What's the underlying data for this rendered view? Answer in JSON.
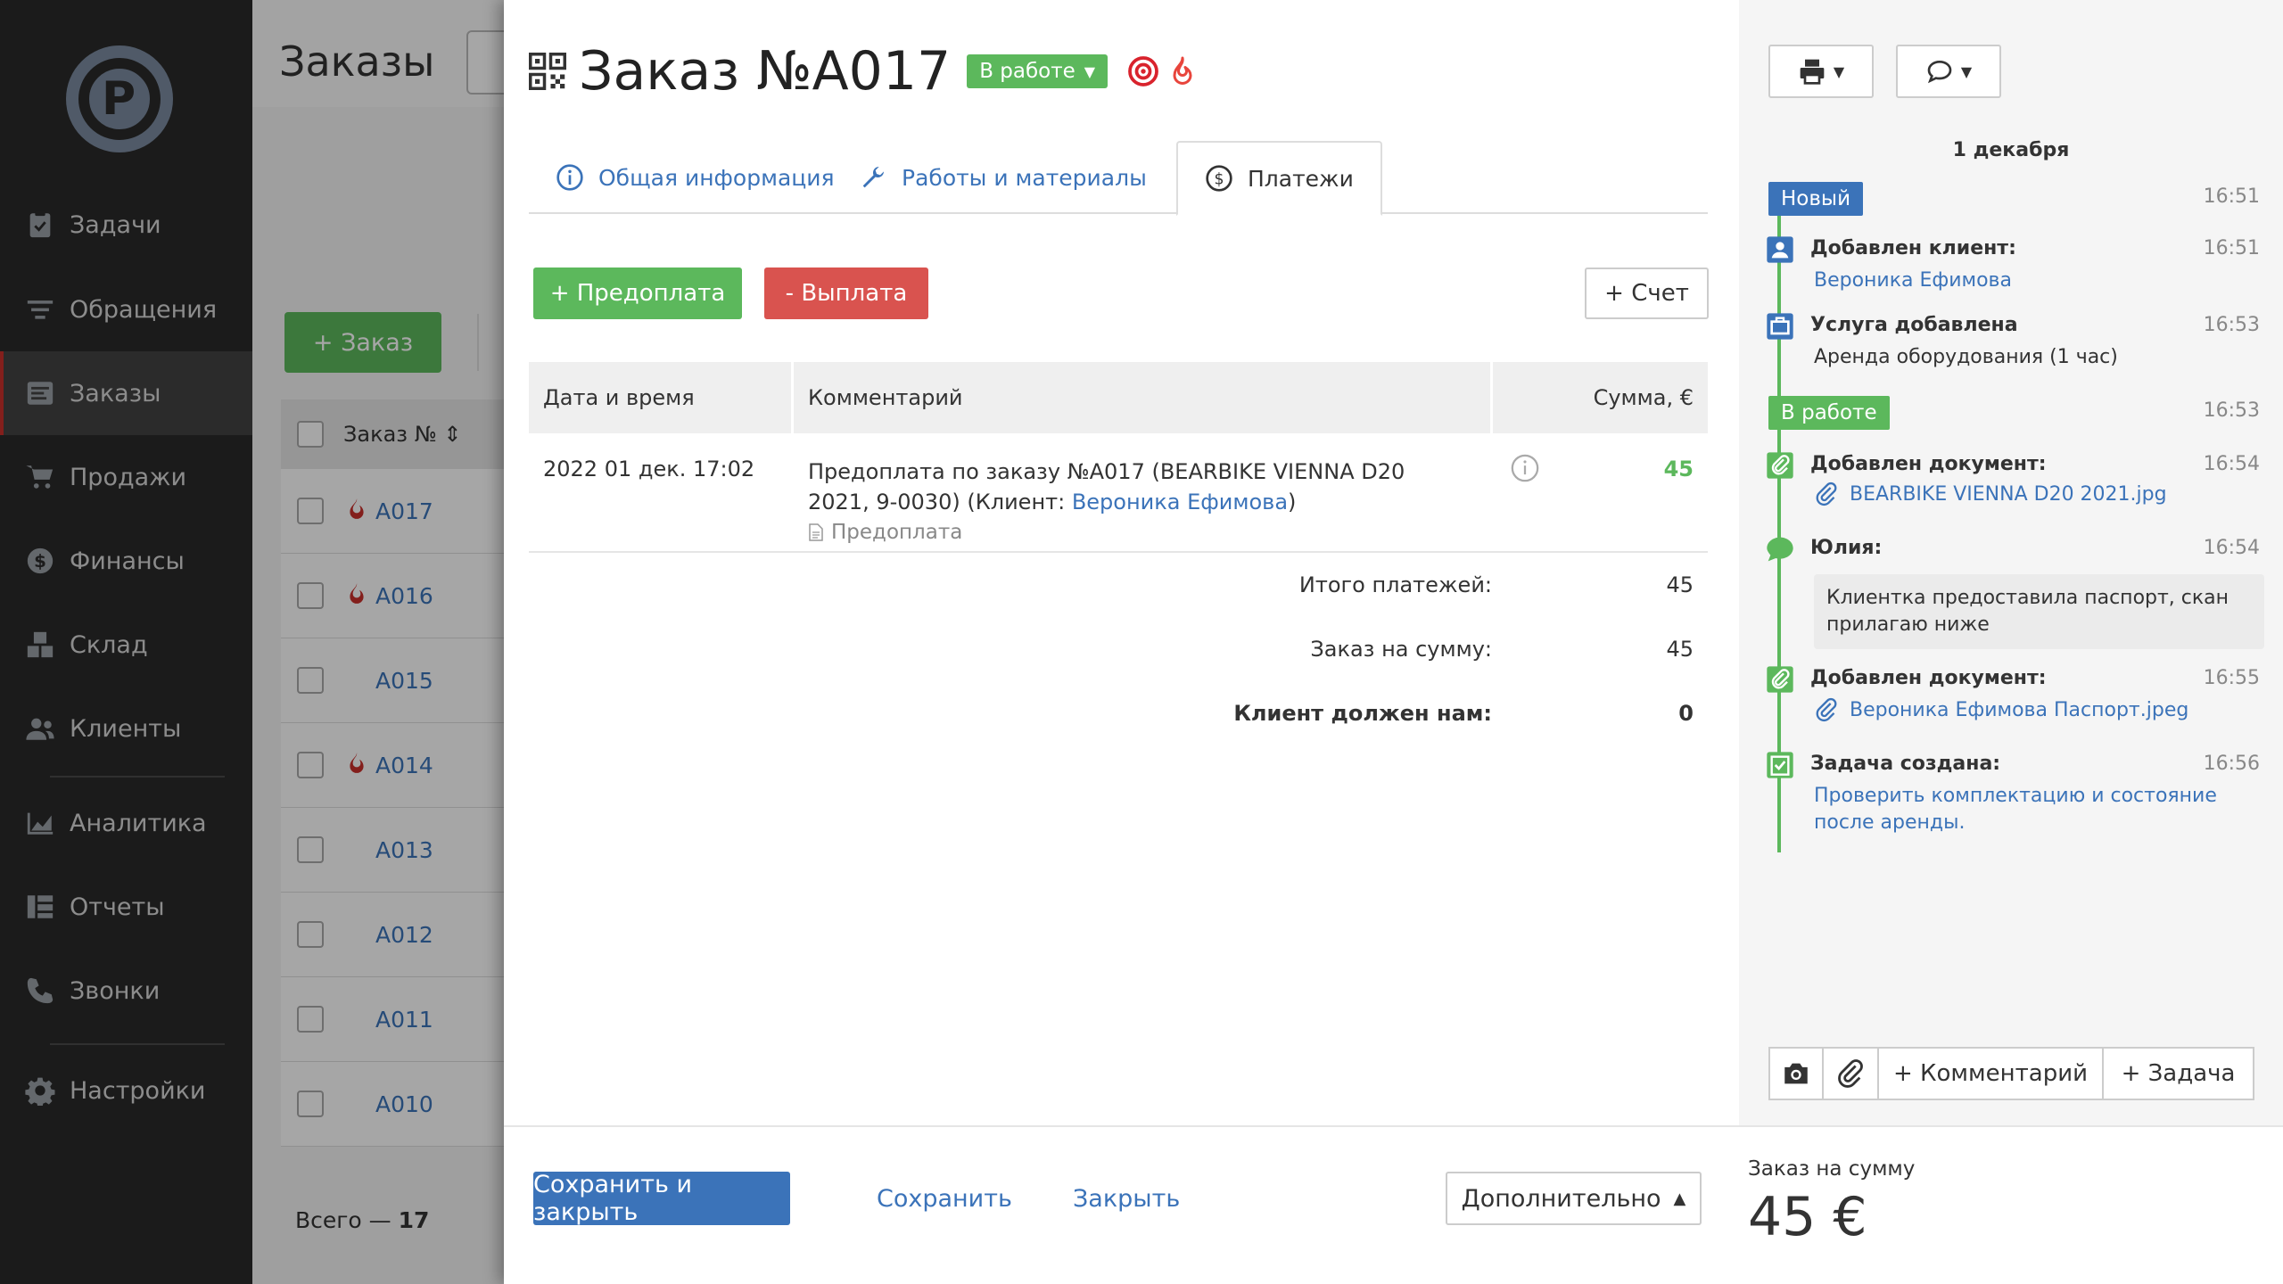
{
  "sidebar": {
    "items": [
      {
        "label": "Задачи",
        "icon": "clipboard-check-icon"
      },
      {
        "label": "Обращения",
        "icon": "filter-icon"
      },
      {
        "label": "Заказы",
        "icon": "orders-icon",
        "active": true
      },
      {
        "label": "Продажи",
        "icon": "cart-icon"
      },
      {
        "label": "Финансы",
        "icon": "dollar-icon"
      },
      {
        "label": "Склад",
        "icon": "boxes-icon"
      },
      {
        "label": "Клиенты",
        "icon": "users-icon"
      },
      {
        "label": "Аналитика",
        "icon": "area-chart-icon"
      },
      {
        "label": "Отчеты",
        "icon": "table-icon"
      },
      {
        "label": "Звонки",
        "icon": "phone-icon"
      },
      {
        "label": "Настройки",
        "icon": "gear-icon"
      }
    ]
  },
  "orders_bg": {
    "title": "Заказы",
    "add_label": "+ Заказ",
    "col_order": "Заказ №",
    "rows": [
      {
        "num": "A017",
        "fire": true
      },
      {
        "num": "A016",
        "fire": true
      },
      {
        "num": "A015",
        "fire": false
      },
      {
        "num": "A014",
        "fire": true
      },
      {
        "num": "A013",
        "fire": false
      },
      {
        "num": "A012",
        "fire": false
      },
      {
        "num": "A011",
        "fire": false
      },
      {
        "num": "A010",
        "fire": false
      }
    ],
    "total_label": "Всего —",
    "total_value": "17"
  },
  "order": {
    "title": "Заказ №A017",
    "status": "В работе"
  },
  "tabs": [
    {
      "label": "Общая информация",
      "icon": "info-icon"
    },
    {
      "label": "Работы и материалы",
      "icon": "wrench-icon"
    },
    {
      "label": "Платежи",
      "icon": "dollar-circle-icon",
      "active": true
    }
  ],
  "buttons": {
    "prepay": "+ Предоплата",
    "payout": "- Выплата",
    "invoice": "+ Счет"
  },
  "table": {
    "headers": {
      "date": "Дата и время",
      "comment": "Комментарий",
      "sum": "Сумма, €"
    },
    "rows": [
      {
        "date": "2022 01 дек. 17:02",
        "comment_prefix": "Предоплата по заказу №A017 (BEARBIKE VIENNA D20 2021, 9-0030)  (Клиент: ",
        "client": "Вероника Ефимова",
        "comment_suffix": ")",
        "type": "Предоплата",
        "sum": "45"
      }
    ]
  },
  "summary": {
    "total_payments_label": "Итого платежей:",
    "total_payments": "45",
    "order_sum_label": "Заказ на сумму:",
    "order_sum": "45",
    "client_owes_label": "Клиент должен нам:",
    "client_owes": "0"
  },
  "footer": {
    "save_close": "Сохранить и закрыть",
    "save": "Сохранить",
    "close": "Закрыть",
    "more": "Дополнительно",
    "total_label": "Заказ на сумму",
    "total_amount": "45 €"
  },
  "timeline": {
    "date": "1 декабря",
    "status_new": {
      "label": "Новый",
      "time": "16:51",
      "color": "#3b73b9"
    },
    "client_added": {
      "title": "Добавлен клиент:",
      "time": "16:51",
      "link": "Вероника Ефимова"
    },
    "service_added": {
      "title": "Услуга добавлена",
      "time": "16:53",
      "text": "Аренда оборудования (1 час)"
    },
    "status_work": {
      "label": "В работе",
      "time": "16:53",
      "color": "#5cb85c"
    },
    "doc1": {
      "title": "Добавлен документ:",
      "time": "16:54",
      "file": "BEARBIKE VIENNA D20 2021.jpg"
    },
    "comment": {
      "author": "Юлия:",
      "time": "16:54",
      "text": "Клиентка предоставила паспорт, скан прилагаю ниже"
    },
    "doc2": {
      "title": "Добавлен документ:",
      "time": "16:55",
      "file": "Вероника Ефимова Паспорт.jpeg"
    },
    "task": {
      "title": "Задача создана:",
      "time": "16:56",
      "link": "Проверить комплектацию и состояние после аренды."
    }
  },
  "right_actions": {
    "comment": "+ Комментарий",
    "task": "+ Задача"
  }
}
